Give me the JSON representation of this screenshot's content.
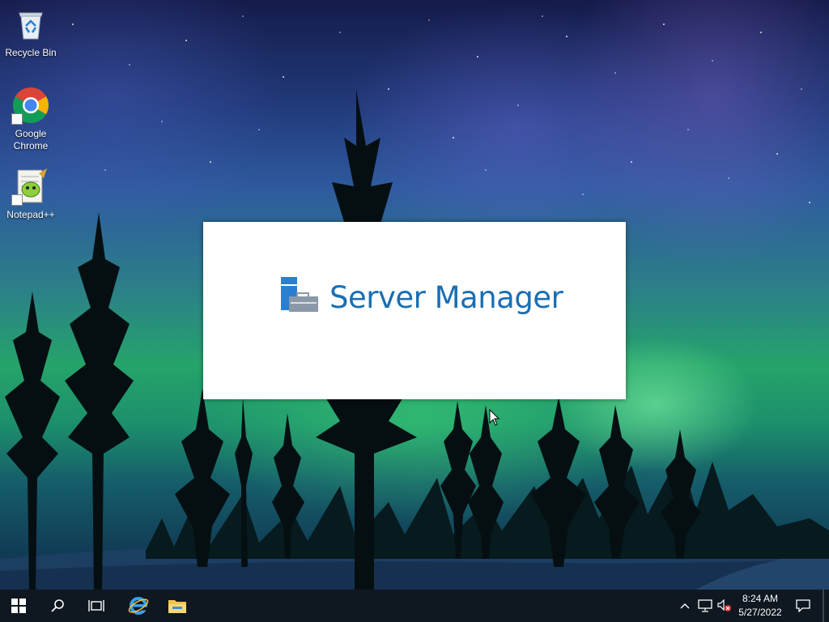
{
  "desktop": {
    "icons": [
      {
        "label": "Recycle Bin",
        "icon": "recycle-bin-icon"
      },
      {
        "label": "Google Chrome",
        "icon": "chrome-icon"
      },
      {
        "label": "Notepad++",
        "icon": "notepadpp-icon"
      }
    ]
  },
  "splash": {
    "title": "Server Manager",
    "icon": "server-manager-icon",
    "accent": "#1a6fb4"
  },
  "taskbar": {
    "buttons": [
      {
        "icon": "windows-start-icon"
      },
      {
        "icon": "search-icon"
      },
      {
        "icon": "task-view-icon"
      },
      {
        "icon": "internet-explorer-icon"
      },
      {
        "icon": "file-explorer-icon"
      }
    ],
    "tray": {
      "icons": [
        "chevron-up-icon",
        "network-icon",
        "volume-muted-icon",
        "notification-icon"
      ],
      "time": "8:24 AM",
      "date": "5/27/2022"
    }
  }
}
